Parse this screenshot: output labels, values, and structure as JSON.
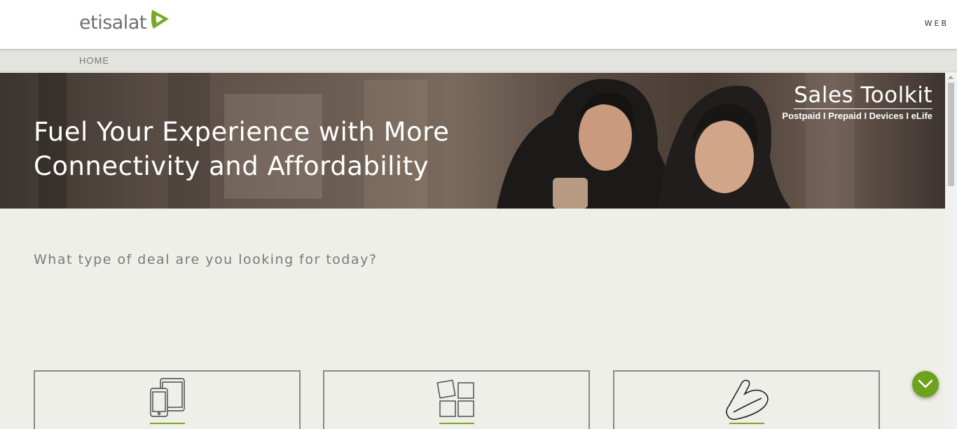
{
  "header": {
    "logo_text": "etisalat",
    "web_label": "WEB"
  },
  "nav": {
    "home_label": "HOME"
  },
  "hero": {
    "headline_line1": "Fuel Your Experience with More",
    "headline_line2": "Connectivity and Affordability",
    "brand_title": "Sales Toolkit",
    "brand_subtitle": "Postpaid I Prepaid I Devices I eLife"
  },
  "main": {
    "question": "What type of deal are you looking for today?",
    "cards": [
      {
        "icon": "devices-icon"
      },
      {
        "icon": "apps-grid-icon"
      },
      {
        "icon": "glove-icon"
      }
    ]
  },
  "colors": {
    "accent": "#6ea11c",
    "underline": "#7aa823",
    "page_background": "#efefea"
  }
}
